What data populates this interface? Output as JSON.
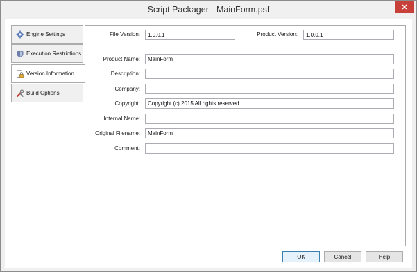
{
  "window": {
    "title": "Script Packager - MainForm.psf",
    "close_icon": "close-icon"
  },
  "tabs": [
    {
      "label": "Engine Settings",
      "icon": "gear-icon",
      "active": false
    },
    {
      "label": "Execution Restrictions",
      "icon": "shield-icon",
      "active": false
    },
    {
      "label": "Version Information",
      "icon": "document-lock-icon",
      "active": true
    },
    {
      "label": "Build Options",
      "icon": "tools-icon",
      "active": false
    }
  ],
  "version_info": {
    "file_version_label": "File Version:",
    "file_version": "1.0.0.1",
    "product_version_label": "Product Version:",
    "product_version": "1.0.0.1",
    "product_name_label": "Product Name:",
    "product_name": "MainForm",
    "description_label": "Description:",
    "description": "",
    "company_label": "Company:",
    "company": "",
    "copyright_label": "Copyright:",
    "copyright": "Copyright (c) 2015 All rights reserved",
    "internal_name_label": "Internal Name:",
    "internal_name": "",
    "original_filename_label": "Original Filename:",
    "original_filename": "MainForm",
    "comment_label": "Comment:",
    "comment": ""
  },
  "buttons": {
    "ok": "OK",
    "cancel": "Cancel",
    "help": "Help"
  },
  "colors": {
    "close_button": "#c7403a",
    "default_button_border": "#3c7fb1"
  }
}
